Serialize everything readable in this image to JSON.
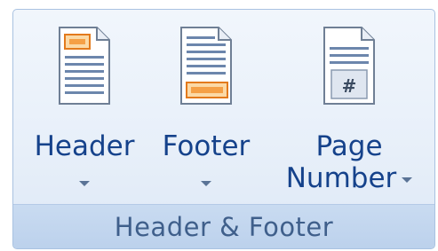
{
  "group": {
    "label": "Header & Footer"
  },
  "buttons": {
    "header": {
      "label": "Header",
      "icon": "header-page-icon"
    },
    "footer": {
      "label": "Footer",
      "icon": "footer-page-icon"
    },
    "page_number": {
      "label_line1": "Page",
      "label_line2": "Number",
      "icon": "page-number-icon"
    }
  },
  "colors": {
    "label_text": "#15428b",
    "group_label_text": "#3f5f8b",
    "accent_orange": "#f5a046"
  }
}
